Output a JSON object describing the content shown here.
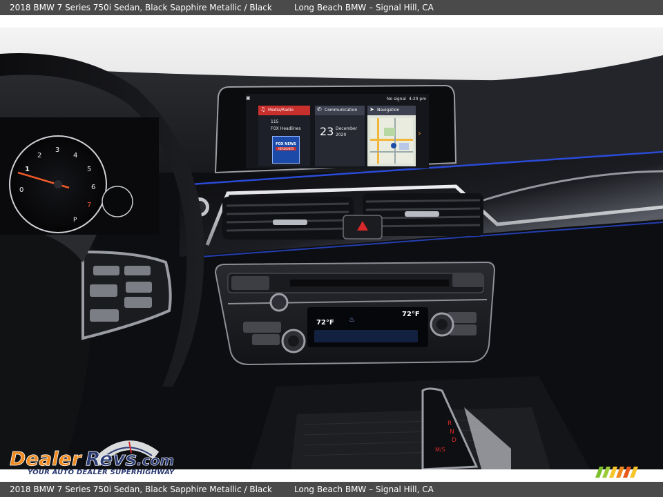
{
  "caption": {
    "vehicle": "2018 BMW 7 Series 750i Sedan,",
    "color": "Black Sapphire Metallic / Black",
    "dealer": "Long Beach BMW – Signal Hill, CA"
  },
  "screen": {
    "status_signal": "No signal",
    "status_time": "4:20 pm",
    "tile_media_title": "Media/Radio",
    "tile_media_channel": "115",
    "tile_media_station": "FOX Headlines",
    "tile_media_logo_top": "FOX NEWS",
    "tile_media_logo_bottom": "HEADLINES",
    "tile_comm_title": "Communication",
    "tile_comm_day": "23",
    "tile_comm_month": "December",
    "tile_comm_year": "2020",
    "tile_nav_title": "Navigation"
  },
  "climate": {
    "left_temp": "72°F",
    "right_temp": "72°F"
  },
  "cluster": {
    "dial_numbers": [
      "0",
      "1",
      "2",
      "3",
      "4",
      "5",
      "6",
      "7"
    ],
    "gear_letter": "P"
  },
  "shifter": {
    "letters": [
      "R",
      "N",
      "D"
    ],
    "mode": "M/S"
  },
  "watermark": {
    "brand": "DealerRevs.com",
    "tagline": "YOUR AUTO DEALER SUPERHIGHWAY"
  },
  "colors": {
    "caption_bar": "#4a4a4a",
    "screen_accent": "#c8302e",
    "ambient_light": "#2a4bd8",
    "watermark_orange": "#f08a1c",
    "watermark_blue": "#2a3a73"
  }
}
